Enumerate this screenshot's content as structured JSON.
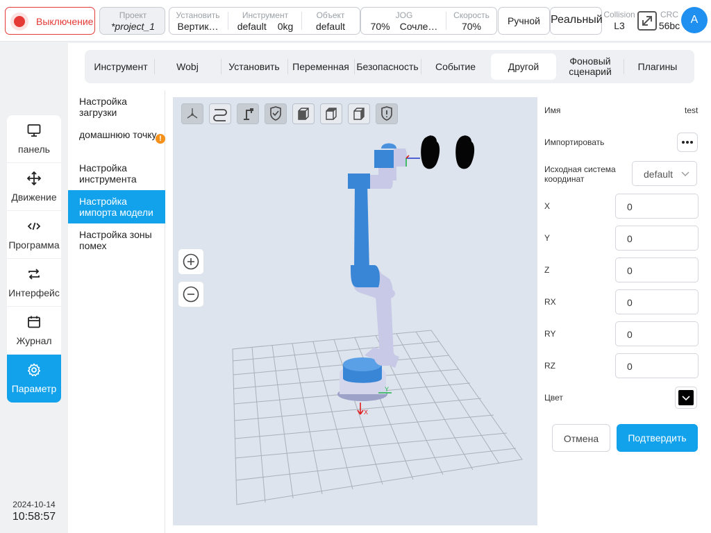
{
  "topbar": {
    "power_label": "Выключение",
    "project": {
      "title": "Проект",
      "value": "*project_1"
    },
    "install": {
      "title": "Установить",
      "value": "Вертик…"
    },
    "tool": {
      "title": "Инструмент",
      "name": "default",
      "weight": "0kg"
    },
    "object": {
      "title": "Объект",
      "value": "default"
    },
    "jog": {
      "title": "JOG",
      "percent": "70%",
      "mode": "Сочле…"
    },
    "speed": {
      "title": "Скорость",
      "value": "70%"
    },
    "manual_label": "Ручной",
    "real_label": "Реальный",
    "collision": {
      "title": "Collision",
      "value": "L3"
    },
    "crc": {
      "title": "CRC",
      "value": "56bc"
    },
    "avatar_letter": "A"
  },
  "sidebar": {
    "items": [
      {
        "label": "панель",
        "icon": "monitor-icon"
      },
      {
        "label": "Движение",
        "icon": "move-arrows-icon"
      },
      {
        "label": "Программа",
        "icon": "code-icon"
      },
      {
        "label": "Интерфейс",
        "icon": "swap-icon"
      },
      {
        "label": "Журнал",
        "icon": "calendar-icon"
      },
      {
        "label": "Параметр",
        "icon": "gear-icon"
      }
    ],
    "active_index": 5,
    "date": "2024-10-14",
    "time": "10:58:57"
  },
  "tabs": [
    "Инструмент",
    "Wobj",
    "Установить",
    "Переменная",
    "Безопасность",
    "Событие",
    "Другой",
    "Фоновый сценарий",
    "Плагины"
  ],
  "active_tab": "Другой",
  "menu": [
    {
      "label": "Настройка загрузки"
    },
    {
      "label": "домашнюю точку",
      "warning": "!"
    },
    {
      "label": "Настройка инструмента"
    },
    {
      "label": "Настройка импорта модели"
    },
    {
      "label": "Настройка зоны помех"
    }
  ],
  "active_menu_index": 3,
  "viewport": {
    "toolbar_icons": [
      "axes-icon",
      "path-icon",
      "robot-icon",
      "shield-check-icon",
      "cube-front-icon",
      "cube-top-icon",
      "cube-side-icon",
      "shield-alert-icon"
    ],
    "zoom_in_icon": "zoom-in-icon",
    "zoom_out_icon": "zoom-out-icon",
    "axis_x_label": "X",
    "axis_y_label": "Y"
  },
  "form": {
    "name_label": "Имя",
    "name_value": "test",
    "import_label": "Импортировать",
    "coord_label": "Исходная система координат",
    "coord_value": "default",
    "x_label": "X",
    "x_value": "0",
    "y_label": "Y",
    "y_value": "0",
    "z_label": "Z",
    "z_value": "0",
    "rx_label": "RX",
    "rx_value": "0",
    "ry_label": "RY",
    "ry_value": "0",
    "rz_label": "RZ",
    "rz_value": "0",
    "color_label": "Цвет",
    "color_value": "#000000",
    "cancel_label": "Отмена",
    "confirm_label": "Подтвердить"
  },
  "colors": {
    "accent": "#12a2ec",
    "danger": "#e53935",
    "warning": "#f5901a",
    "robot_blue": "#3a86d6",
    "robot_lilac": "#c7c9e6"
  }
}
